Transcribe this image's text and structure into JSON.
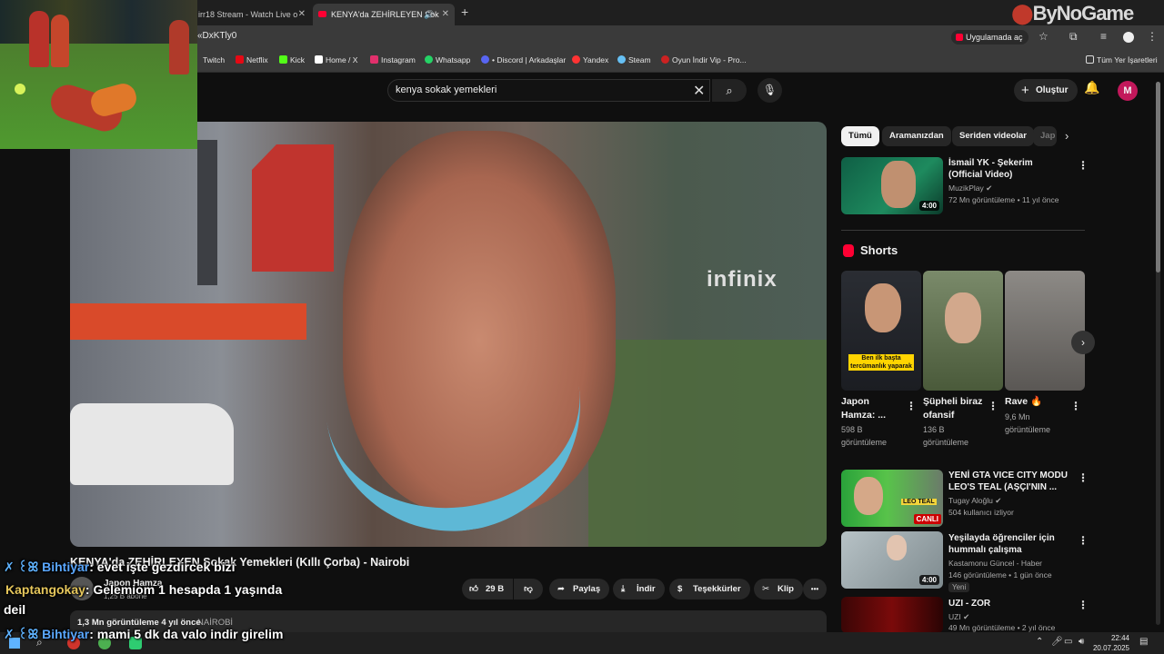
{
  "browser": {
    "tabs": [
      {
        "label": "irr18 Stream - Watch Live o",
        "active": false
      },
      {
        "label": "KENYA'da ZEHİRLEYEN Sok",
        "active": true
      }
    ],
    "new_tab": "+",
    "url": "«DxKTly0",
    "open_in_app": "Uygulamada aç",
    "bookmarks": [
      {
        "label": "Twitch",
        "color": "#9146ff"
      },
      {
        "label": "Netflix",
        "color": "#e50914"
      },
      {
        "label": "Kick",
        "color": "#53fc18"
      },
      {
        "label": "Home / X",
        "color": "#ffffff"
      },
      {
        "label": "Instagram",
        "color": "#e1306c"
      },
      {
        "label": "Whatsapp",
        "color": "#25d366"
      },
      {
        "label": "• Discord | Arkadaşlar",
        "color": "#5865f2"
      },
      {
        "label": "Yandex",
        "color": "#ff3333"
      },
      {
        "label": "Steam",
        "color": "#66c0f4"
      },
      {
        "label": "Oyun İndir Vip - Pro...",
        "color": "#cc2222"
      }
    ],
    "all_bookmarks": "Tüm Yer İşaretleri"
  },
  "overlay": {
    "logo_by": "By",
    "logo_nogame": "NoGame"
  },
  "youtube": {
    "search_value": "kenya sokak yemekleri",
    "create_label": "Oluştur",
    "avatar_letter": "M",
    "video": {
      "title": "KENYA'da ZEHİRLEYEN Sokak Yemekleri (Kıllı Çorba) - Nairobi",
      "channel": "Japon Hamza",
      "subs": "1,25 B abone",
      "likes": "29 B",
      "share": "Paylaş",
      "download": "İndir",
      "thanks": "Teşekkürler",
      "clip": "Klip",
      "more": "•••",
      "views": "1,3 Mn görüntüleme  4 yıl önce",
      "tag": "NAİROBİ",
      "player_brand": "infinix"
    },
    "chips": [
      {
        "label": "Tümü",
        "selected": true
      },
      {
        "label": "Aramanızdan",
        "selected": false
      },
      {
        "label": "Seriden videolar",
        "selected": false
      },
      {
        "label": "Jap",
        "selected": false
      }
    ],
    "related_top": {
      "title": "İsmail YK - Şekerim (Official Video)",
      "channel": "MuzikPlay",
      "meta": "72 Mn görüntüleme • 11 yıl önce",
      "duration": "4:00"
    },
    "shorts_heading": "Shorts",
    "shorts": [
      {
        "title": "Japon Hamza: ...",
        "views1": "598 B",
        "views2": "görüntüleme",
        "caption": "Ben ilk başta tercümanlık yaparak"
      },
      {
        "title": "Şüpheli biraz ofansif",
        "views1": "136 B",
        "views2": "görüntüleme"
      },
      {
        "title": "Rave 🔥",
        "views1": "9,6 Mn",
        "views2": "görüntüleme"
      }
    ],
    "related": [
      {
        "title": "YENİ GTA VICE CITY MODU LEO'S TEAL (AŞÇI'NIN ...",
        "channel": "Tugay Aloğlu",
        "meta": "504 kullanıcı izliyor",
        "badge": "CANLI",
        "thumb_text": "LEO TEAL"
      },
      {
        "title": "Yeşilayda öğrenciler için hummalı çalışma",
        "channel": "Kastamonu Güncel - Haber",
        "meta": "146 görüntüleme • 1 gün önce",
        "badge": "Yeni",
        "duration": "4:00"
      },
      {
        "title": "UZI - ZOR",
        "channel": "UZI",
        "meta": "49 Mn görüntüleme • 2 yıl önce"
      }
    ]
  },
  "chat": [
    {
      "badge": "✗ ꒰ꕤ",
      "user": "Bihtiyar",
      "msg": ": evet işte gezdircek bizi"
    },
    {
      "user": "Kaptangokay",
      "msg": ": Gelemiom 1 hesapda 1 yaşında",
      "cont": "deil"
    },
    {
      "badge": "✗ ꒰ꕤ",
      "user": "Bihtiyar",
      "msg": ": mami 5 dk da valo indir girelim"
    }
  ],
  "taskbar": {
    "time": "22:44",
    "date": "20.07.2025"
  }
}
